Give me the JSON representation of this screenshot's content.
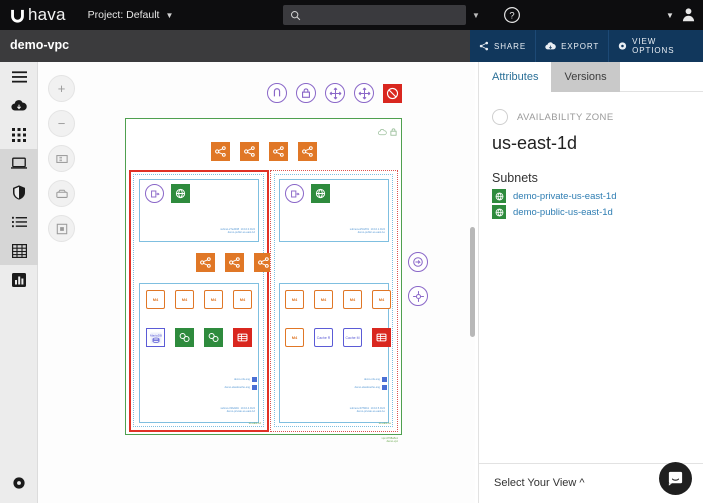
{
  "topbar": {
    "logo_text": "hava",
    "logo_icon": "hava-logo-icon",
    "project_label": "Project: Default",
    "project_chevron": "chevron-down-icon",
    "search_placeholder": "",
    "search_value": "",
    "search_icon": "search-icon",
    "search_chevron": "chevron-down-icon",
    "help_icon": "help-circle-icon",
    "account_chevron": "chevron-down-icon",
    "avatar_icon": "user-avatar-icon"
  },
  "subbar": {
    "title": "demo-vpc",
    "actions": [
      {
        "label": "SHARE",
        "icon": "share-icon"
      },
      {
        "label": "EXPORT",
        "icon": "cloud-download-icon"
      },
      {
        "label": "VIEW OPTIONS",
        "icon": "gear-icon"
      }
    ],
    "accent": "#11375c"
  },
  "sidebar": {
    "items": [
      {
        "name": "menu-icon",
        "group": "top"
      },
      {
        "name": "cloud-import-icon",
        "group": "top"
      },
      {
        "name": "apps-grid-icon",
        "group": "top"
      },
      {
        "name": "environments-icon",
        "group": "active"
      },
      {
        "name": "security-shield-icon",
        "group": "active"
      },
      {
        "name": "list-icon",
        "group": "active"
      },
      {
        "name": "table-grid-icon",
        "group": "active"
      },
      {
        "name": "reports-chart-icon",
        "group": "bottom"
      }
    ],
    "settings_icon": "gear-icon"
  },
  "canvas_tools": [
    {
      "name": "zoom-in-button",
      "glyph": "+"
    },
    {
      "name": "zoom-out-button",
      "glyph": "−"
    },
    {
      "name": "fit-to-screen-button",
      "glyph": "fit-icon"
    },
    {
      "name": "pan-tool-button",
      "glyph": "pan-icon"
    },
    {
      "name": "select-tool-button",
      "glyph": "select-icon"
    }
  ],
  "diagram": {
    "vpc_label": "vpc-0768e8e1",
    "vpc_name": "demo-vpc",
    "top_gateways": [
      {
        "name": "internet-gateway-icon",
        "color": "#8a67c8"
      },
      {
        "name": "vpn-gateway-icon",
        "color": "#8a67c8"
      },
      {
        "name": "route-table-icon",
        "color": "#8a67c8"
      },
      {
        "name": "route-table-icon-2",
        "color": "#8a67c8"
      },
      {
        "name": "network-acl-icon",
        "color": "#d9271f"
      }
    ],
    "side_gateways": [
      {
        "name": "nat-gateway-icon",
        "color": "#8a67c8"
      },
      {
        "name": "route-propagation-icon",
        "color": "#8a67c8"
      }
    ],
    "buckets": [
      {
        "name": "s3-bucket-icon",
        "color": "#4fa04f"
      },
      {
        "name": "s3-bucket-icon-2",
        "color": "#4fa04f"
      }
    ],
    "elb_top": [
      {
        "name": "elb-1"
      },
      {
        "name": "elb-2"
      },
      {
        "name": "elb-3"
      },
      {
        "name": "elb-4"
      }
    ],
    "elb_mid": [
      {
        "name": "elb-5"
      },
      {
        "name": "elb-6"
      },
      {
        "name": "elb-7-selected"
      },
      {
        "name": "elb-8"
      },
      {
        "name": "elb-9"
      }
    ],
    "zones": [
      {
        "id": "az-us-east-1d",
        "selected": true,
        "az_label": "us-east-1d",
        "public_subnet": {
          "subnet_id": "subnet-27ed008",
          "cidr": "10.10.0.0/24",
          "name": "demo-public-us-east-1d",
          "route_table_icon": "route-table-icon",
          "subnet_icon": "subnet-icon"
        },
        "private_subnet": {
          "subnet_id": "subnet-33bdd0c",
          "cidr": "10.10.4.0/24",
          "name": "demo-private-us-east-1d",
          "instances": [
            "M4",
            "M4",
            "M4",
            "M4"
          ],
          "services": [
            {
              "name": "mariadb-rds-icon",
              "label": "MariaDB"
            },
            {
              "name": "elasticache-node-icon",
              "label": ""
            },
            {
              "name": "elasticache-node-icon-2",
              "label": ""
            },
            {
              "name": "rds-database-icon",
              "label": ""
            }
          ],
          "groups": [
            {
              "label": "demo-rds-sng",
              "icon": "subnet-group-icon"
            },
            {
              "label": "demo-elasticache-sng",
              "icon": "subnet-group-icon"
            }
          ]
        }
      },
      {
        "id": "az-us-east-1e",
        "selected": false,
        "az_label": "us-east-1e",
        "public_subnet": {
          "subnet_id": "subnet-e25c2f01",
          "cidr": "10.10.1.0/24",
          "name": "demo-public-us-east-1e",
          "route_table_icon": "route-table-icon",
          "subnet_icon": "subnet-icon"
        },
        "private_subnet": {
          "subnet_id": "subnet-c47f9bb1",
          "cidr": "10.10.5.0/24",
          "name": "demo-private-us-east-1e",
          "instances": [
            "M4",
            "M4",
            "M4",
            "M4",
            "M4"
          ],
          "services": [
            {
              "name": "elasticache-redis-icon",
              "label": "Cache R"
            },
            {
              "name": "elasticache-memcached-icon",
              "label": "Cache M"
            },
            {
              "name": "rds-database-icon",
              "label": ""
            }
          ],
          "groups": [
            {
              "label": "demo-rds-sng",
              "icon": "subnet-group-icon"
            },
            {
              "label": "demo-elasticache-sng",
              "icon": "subnet-group-icon"
            }
          ]
        }
      }
    ]
  },
  "panel": {
    "tabs": [
      {
        "label": "Attributes",
        "active": true
      },
      {
        "label": "Versions",
        "active": false
      }
    ],
    "resource_type": "AVAILABILITY ZONE",
    "resource_name": "us-east-1d",
    "subnets_heading": "Subnets",
    "subnets": [
      {
        "label": "demo-private-us-east-1d",
        "icon": "subnet-icon"
      },
      {
        "label": "demo-public-us-east-1d",
        "icon": "subnet-icon"
      }
    ],
    "footer_label": "Select Your View ^",
    "chat_icon": "intercom-chat-icon"
  }
}
